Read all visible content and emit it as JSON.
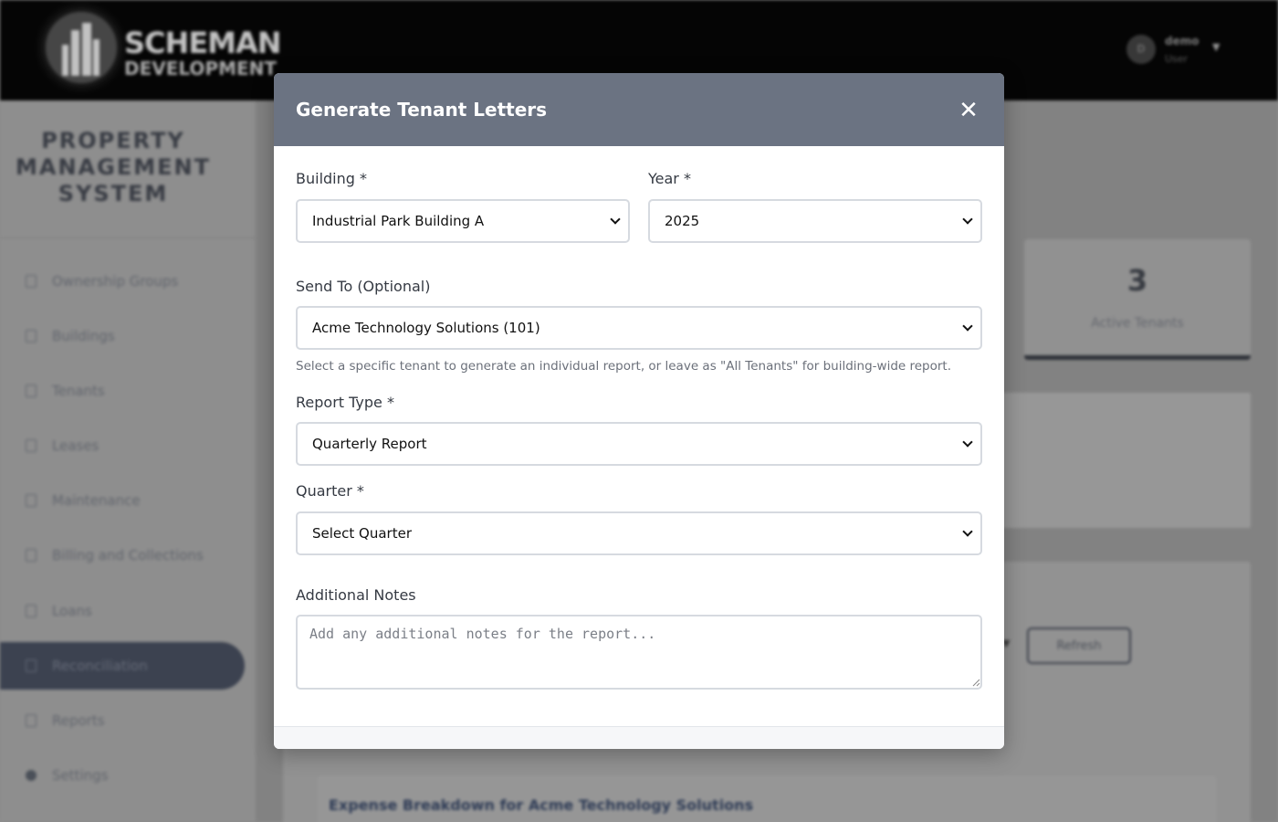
{
  "brand": {
    "line1": "SCHEMAN",
    "line2": "DEVELOPMENT"
  },
  "user": {
    "initial": "D",
    "name": "demo",
    "role": "User"
  },
  "sidebar": {
    "title": [
      "PROPERTY",
      "MANAGEMENT",
      "SYSTEM"
    ],
    "items": [
      {
        "label": "Ownership Groups"
      },
      {
        "label": "Buildings"
      },
      {
        "label": "Tenants"
      },
      {
        "label": "Leases"
      },
      {
        "label": "Maintenance"
      },
      {
        "label": "Billing and Collections"
      },
      {
        "label": "Loans"
      },
      {
        "label": "Reconciliation",
        "active": true
      },
      {
        "label": "Reports"
      },
      {
        "label": "Settings"
      }
    ]
  },
  "main": {
    "stat": {
      "value": "3",
      "label": "Active Tenants"
    },
    "refresh_label": "Refresh",
    "expense_title": "Expense Breakdown for Acme Technology Solutions"
  },
  "modal": {
    "title": "Generate Tenant Letters",
    "close_glyph": "✕",
    "building": {
      "label": "Building *",
      "value": "Industrial Park Building A"
    },
    "year": {
      "label": "Year *",
      "value": "2025"
    },
    "send_to": {
      "label": "Send To (Optional)",
      "value": "Acme Technology Solutions (101)",
      "help": "Select a specific tenant to generate an individual report, or leave as \"All Tenants\" for building-wide report."
    },
    "report_type": {
      "label": "Report Type *",
      "value": "Quarterly Report"
    },
    "quarter": {
      "label": "Quarter *",
      "value": "Select Quarter"
    },
    "notes": {
      "label": "Additional Notes",
      "placeholder": "Add any additional notes for the report..."
    }
  }
}
